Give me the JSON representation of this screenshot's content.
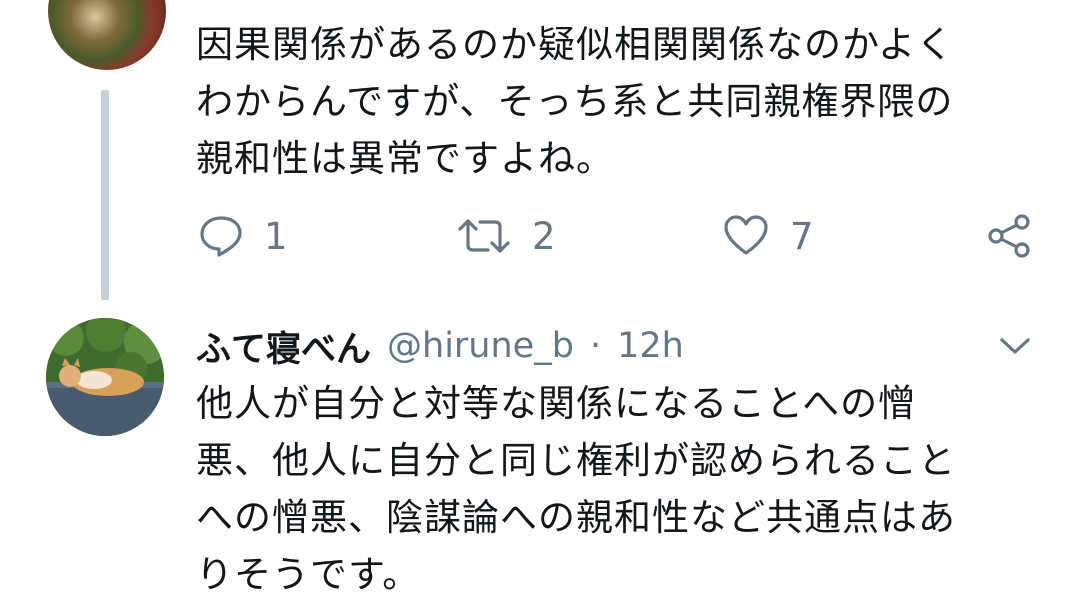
{
  "tweet1": {
    "text_lines": [
      "因果関係があるのか疑似相関関係なのかよく",
      "わからんですが、そっち系と共同親権界隈の",
      "親和性は異常ですよね。"
    ],
    "reply_count": "1",
    "retweet_count": "2",
    "like_count": "7"
  },
  "tweet2": {
    "display_name": "ふて寝べん",
    "handle": "@hirune_b",
    "separator": "·",
    "time": "12h",
    "text_lines": [
      "他人が自分と対等な関係になることへの憎",
      "悪、他人に自分と同じ権利が認められること",
      "への憎悪、陰謀論への親和性など共通点はあ",
      "りそうです。"
    ]
  },
  "icons": {
    "reply": "reply-icon",
    "retweet": "retweet-icon",
    "like": "heart-icon",
    "share": "share-icon",
    "more": "chevron-down-icon"
  },
  "colors": {
    "text": "#14171a",
    "secondary": "#657786",
    "thread_line": "#c7d0d8"
  }
}
